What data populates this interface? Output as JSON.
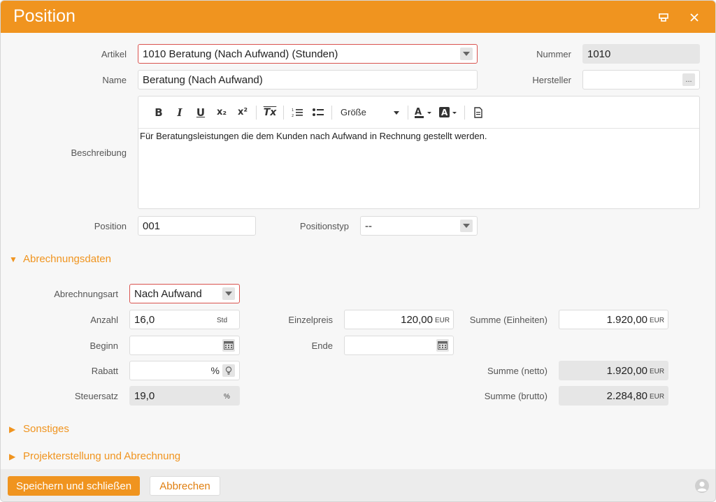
{
  "window": {
    "title": "Position"
  },
  "fields": {
    "artikel": {
      "label": "Artikel",
      "value": "1010 Beratung (Nach Aufwand) (Stunden)"
    },
    "nummer": {
      "label": "Nummer",
      "value": "1010"
    },
    "name": {
      "label": "Name",
      "value": "Beratung (Nach Aufwand)"
    },
    "hersteller": {
      "label": "Hersteller",
      "value": "",
      "button": "..."
    },
    "beschreibung": {
      "label": "Beschreibung",
      "value": "Für Beratungsleistungen die dem Kunden nach Aufwand in Rechnung gestellt werden."
    },
    "position": {
      "label": "Position",
      "value": "001"
    },
    "positionstyp": {
      "label": "Positionstyp",
      "value": "--"
    }
  },
  "editor_toolbar": {
    "bold": "B",
    "italic": "I",
    "underline": "U",
    "subscript": "x₂",
    "superscript": "x²",
    "clear_format": "Tx",
    "size_label": "Größe"
  },
  "sections": {
    "abrechnungsdaten": "Abrechnungsdaten",
    "sonstiges": "Sonstiges",
    "projekt": "Projekterstellung und Abrechnung"
  },
  "billing": {
    "abrechnungsart": {
      "label": "Abrechnungsart",
      "value": "Nach Aufwand"
    },
    "anzahl": {
      "label": "Anzahl",
      "value": "16,0",
      "unit": "Std"
    },
    "einzelpreis": {
      "label": "Einzelpreis",
      "value": "120,00",
      "unit": "EUR"
    },
    "summe_einheiten": {
      "label": "Summe (Einheiten)",
      "value": "1.920,00",
      "unit": "EUR"
    },
    "beginn": {
      "label": "Beginn",
      "value": ""
    },
    "ende": {
      "label": "Ende",
      "value": ""
    },
    "rabatt": {
      "label": "Rabatt",
      "value": "",
      "unit": "%"
    },
    "summe_netto": {
      "label": "Summe (netto)",
      "value": "1.920,00",
      "unit": "EUR"
    },
    "steuersatz": {
      "label": "Steuersatz",
      "value": "19,0",
      "unit": "%"
    },
    "summe_brutto": {
      "label": "Summe (brutto)",
      "value": "2.284,80",
      "unit": "EUR"
    }
  },
  "footer": {
    "save_label": "Speichern und schließen",
    "cancel_label": "Abbrechen"
  },
  "colors": {
    "accent": "#f0941f",
    "error_border": "#d9534f",
    "readonly_bg": "#e6e6e6"
  }
}
